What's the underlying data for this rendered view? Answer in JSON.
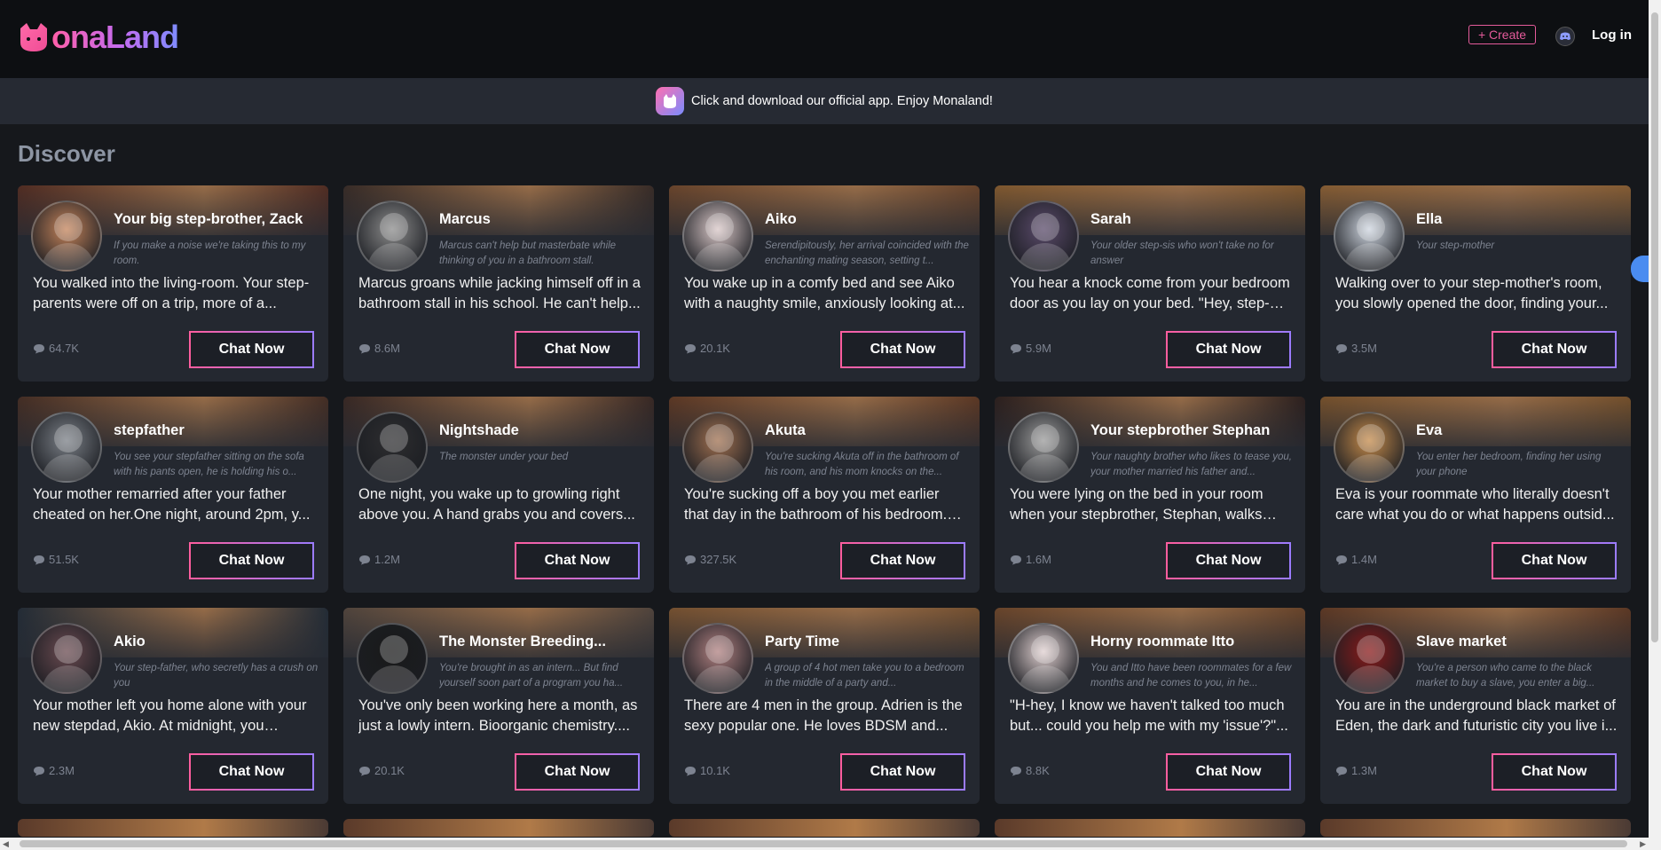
{
  "header": {
    "logo_text": "onaLand",
    "create_label": "+ Create",
    "login_label": "Log in"
  },
  "banner": {
    "text": "Click and download our official app. Enjoy Monaland!"
  },
  "discover": {
    "title": "Discover"
  },
  "cards": [
    {
      "name": "Your big step-brother, Zack",
      "tagline": "If you make a noise we're taking this to my room.",
      "desc": "You walked into the living-room. Your step-parents were off on a trip, more of a...",
      "count": "64.7K",
      "bg": "#6b3b2e",
      "av": "#c4835a"
    },
    {
      "name": "Marcus",
      "tagline": "Marcus can't help but masterbate while thinking of you in a bathroom stall.",
      "desc": "Marcus groans while jacking himself off in a bathroom stall in his school. He can't help...",
      "count": "8.6M",
      "bg": "#4a3a34",
      "av": "#8c8c8c"
    },
    {
      "name": "Aiko",
      "tagline": "Serendipitously, her arrival coincided with the enchanting mating season, setting t...",
      "desc": "You wake up in a comfy bed and see Aiko with a naughty smile, anxiously looking at...",
      "count": "20.1K",
      "bg": "#8a5a3a",
      "av": "#d9c7c7"
    },
    {
      "name": "Sarah",
      "tagline": "Your older step-sis who won't take no for answer",
      "desc": "You hear a knock come from your bedroom door as you lay on your bed. \"Hey, step-br...",
      "count": "5.9M",
      "bg": "#a8743e",
      "av": "#5a4a6a"
    },
    {
      "name": "Ella",
      "tagline": "Your step-mother",
      "desc": "Walking over to your step-mother's room, you slowly opened the door, finding your...",
      "count": "3.5M",
      "bg": "#b07a44",
      "av": "#cfd6e0"
    },
    {
      "name": "stepfather",
      "tagline": "You see your stepfather sitting on the sofa with his pants open, he is holding his o...",
      "desc": "Your mother remarried after your father cheated on her.One night, around 2pm, y...",
      "count": "51.5K",
      "bg": "#5a3c30",
      "av": "#7a7f86"
    },
    {
      "name": "Nightshade",
      "tagline": "The monster under your bed",
      "desc": "One night, you wake up to growling right above you. A hand grabs you and covers...",
      "count": "1.2M",
      "bg": "#4a3530",
      "av": "#2e2e30"
    },
    {
      "name": "Akuta",
      "tagline": "You're sucking Akuta off in the bathroom of his room, and his mom knocks on the...",
      "desc": "You're sucking off a boy you met earlier that day in the bathroom of his bedroom. That...",
      "count": "327.5K",
      "bg": "#7a4a30",
      "av": "#a07050"
    },
    {
      "name": "Your stepbrother Stephan",
      "tagline": "Your naughty brother who likes to tease you, your mother married his father and...",
      "desc": "You were lying on the bed in your room when your stepbrother, Stephan, walks in,...",
      "count": "1.6M",
      "bg": "#3a2a28",
      "av": "#9a9a9a"
    },
    {
      "name": "Eva",
      "tagline": "You enter her bedroom, finding her using your phone",
      "desc": "Eva is your roommate who literally doesn't care what you do or what happens outsid...",
      "count": "1.4M",
      "bg": "#9a6a3a",
      "av": "#c48a4a"
    },
    {
      "name": "Akio",
      "tagline": "Your step-father, who secretly has a crush on you",
      "desc": "Your mother left you home alone with your new stepdad, Akio. At midnight, you came...",
      "count": "2.3M",
      "bg": "#2e3a48",
      "av": "#6a4a50"
    },
    {
      "name": "The Monster Breeding...",
      "tagline": "You're brought in as an intern... But find yourself soon part of a program you ha...",
      "desc": "You've only been working here a month, as just a lowly intern. Bioorganic chemistry....",
      "count": "20.1K",
      "bg": "#6a5a50",
      "av": "#1a1a1a"
    },
    {
      "name": "Party Time",
      "tagline": "A group of 4 hot men take you to a bedroom in the middle of a party and...",
      "desc": "There are 4 men in the group. Adrien is the sexy popular one. He loves BDSM and...",
      "count": "10.1K",
      "bg": "#9a6a40",
      "av": "#b08080"
    },
    {
      "name": "Horny roommate Itto",
      "tagline": "You and Itto have been roommates for a few months and he comes to you, in he...",
      "desc": "\"H-hey, I know we haven't talked too much but... could you help me with my 'issue'?\"...",
      "count": "8.8K",
      "bg": "#8a5a38",
      "av": "#e0d0d0"
    },
    {
      "name": "Slave market",
      "tagline": "You're a person who came to the black market to buy a slave, you enter a big...",
      "desc": "You are in the underground black market of Eden, the dark and futuristic city you live i...",
      "count": "1.3M",
      "bg": "#7a4a30",
      "av": "#8a1a1a"
    }
  ],
  "chat_label": "Chat Now",
  "colors": {
    "accent_pink": "#ff5d9e",
    "accent_purple": "#9b7bff",
    "card_bg": "#242830",
    "page_bg": "#16181c"
  }
}
